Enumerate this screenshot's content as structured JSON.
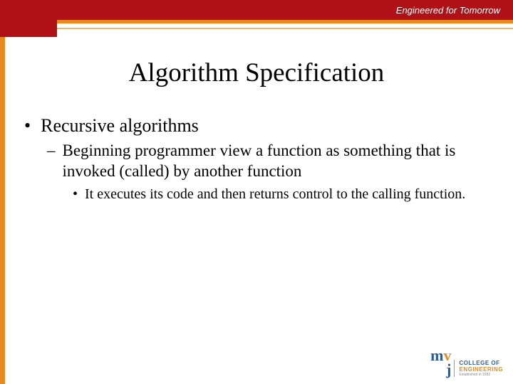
{
  "header": {
    "tagline": "Engineered for Tomorrow"
  },
  "slide": {
    "title": "Algorithm Specification",
    "bullets": {
      "l1": "Recursive algorithms",
      "l2": "Beginning programmer view a function as something that is invoked (called) by another function",
      "l3": "It executes its code and then returns control to the calling function."
    }
  },
  "logo": {
    "m": "m",
    "v": "v",
    "j": "j",
    "line1": "COLLEGE OF",
    "line2": "ENGINEERING",
    "line3": "Established in 1982"
  }
}
